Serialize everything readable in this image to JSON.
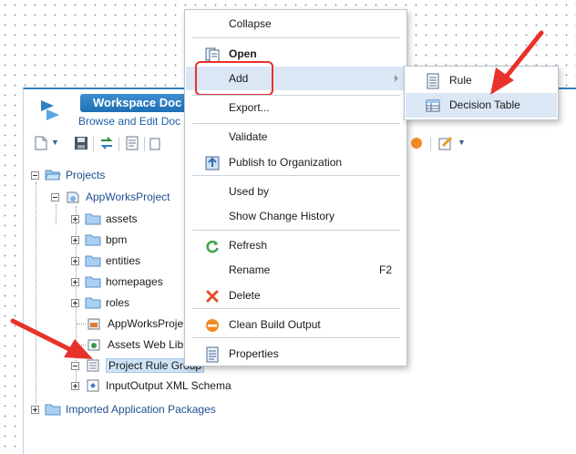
{
  "workspace": {
    "title": "Workspace Doc",
    "subtitle": "Browse and Edit Doc"
  },
  "tree": {
    "items": [
      {
        "label": "Projects",
        "type": "folder",
        "expanded": true
      },
      {
        "label": "AppWorksProject",
        "type": "project",
        "expanded": true
      },
      {
        "label": "assets",
        "type": "folder"
      },
      {
        "label": "bpm",
        "type": "folder"
      },
      {
        "label": "entities",
        "type": "folder"
      },
      {
        "label": "homepages",
        "type": "folder"
      },
      {
        "label": "roles",
        "type": "folder"
      },
      {
        "label": "AppWorksProje",
        "type": "package"
      },
      {
        "label": "Assets Web Lib",
        "type": "weblib"
      },
      {
        "label": "Project Rule Group",
        "type": "rulegroup",
        "selected": true
      },
      {
        "label": "InputOutput XML Schema",
        "type": "schema"
      },
      {
        "label": "Imported Application Packages",
        "type": "folder"
      }
    ]
  },
  "context_menu": {
    "items": [
      {
        "label": "Collapse",
        "icon": "none"
      },
      {
        "label": "Open",
        "icon": "open-icon"
      },
      {
        "label": "Add",
        "icon": "none",
        "submenu": true,
        "highlighted": true
      },
      {
        "label": "Export...",
        "icon": "none"
      },
      {
        "label": "Validate",
        "icon": "none"
      },
      {
        "label": "Publish to Organization",
        "icon": "publish-icon"
      },
      {
        "label": "Used by",
        "icon": "none"
      },
      {
        "label": "Show Change History",
        "icon": "none"
      },
      {
        "label": "Refresh",
        "icon": "refresh-icon"
      },
      {
        "label": "Rename",
        "icon": "none",
        "shortcut": "F2"
      },
      {
        "label": "Delete",
        "icon": "delete-icon"
      },
      {
        "label": "Clean Build Output",
        "icon": "clean-build-icon"
      },
      {
        "label": "Properties",
        "icon": "properties-icon"
      }
    ]
  },
  "submenu": {
    "items": [
      {
        "label": "Rule",
        "icon": "rule-icon"
      },
      {
        "label": "Decision Table",
        "icon": "decision-table-icon",
        "highlighted": true
      }
    ]
  },
  "colors": {
    "accent": "#2f7fc1",
    "highlight": "#dbe7f5",
    "annotation_red": "#e8312b"
  }
}
